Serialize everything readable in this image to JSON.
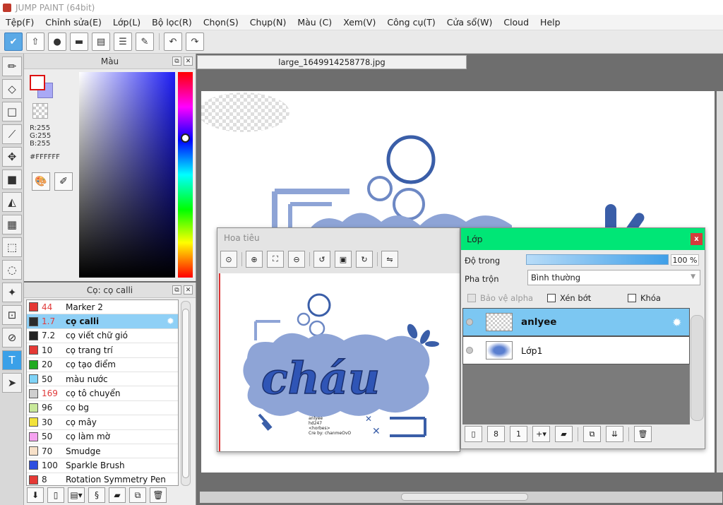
{
  "window": {
    "title": "JUMP PAINT (64bit)"
  },
  "menu": [
    "Tệp(F)",
    "Chỉnh sửa(E)",
    "Lớp(L)",
    "Bộ lọc(R)",
    "Chọn(S)",
    "Chụp(N)",
    "Màu (C)",
    "Xem(V)",
    "Công cụ(T)",
    "Cửa sổ(W)",
    "Cloud",
    "Help"
  ],
  "color_panel": {
    "title": "Màu",
    "rgb": {
      "r": "R:255",
      "g": "G:255",
      "b": "B:255"
    },
    "hex": "#FFFFFF",
    "fg_color": "#ffffff",
    "bg_color": "#a9a9f5"
  },
  "brush_panel": {
    "title": "Cọ: cọ calli",
    "items": [
      {
        "size": "44",
        "name": "Marker 2",
        "color": "#e53935",
        "size_red": true
      },
      {
        "size": "1.7",
        "name": "cọ calli",
        "color": "#2b2b2b",
        "size_red": true,
        "selected": true
      },
      {
        "size": "7.2",
        "name": "cọ viết chữ gió",
        "color": "#222222"
      },
      {
        "size": "10",
        "name": "cọ trang trí",
        "color": "#e53935"
      },
      {
        "size": "20",
        "name": "cọ tạo điểm",
        "color": "#22aa22"
      },
      {
        "size": "50",
        "name": "màu nước",
        "color": "#7fd3f7"
      },
      {
        "size": "169",
        "name": "cọ tô chuyển",
        "color": "#cfcfcf",
        "size_red": true
      },
      {
        "size": "96",
        "name": "cọ bg",
        "color": "#c8e89a"
      },
      {
        "size": "30",
        "name": "cọ mây",
        "color": "#f2e23a"
      },
      {
        "size": "50",
        "name": "cọ làm mờ",
        "color": "#f5a3f0"
      },
      {
        "size": "70",
        "name": "Smudge",
        "color": "#f7e0c8"
      },
      {
        "size": "100",
        "name": "Sparkle Brush",
        "color": "#2e4fe0"
      },
      {
        "size": "8",
        "name": "Rotation Symmetry Pen",
        "color": "#e53935"
      }
    ]
  },
  "document": {
    "tab": "large_1649914258778.jpg"
  },
  "navigator": {
    "title": "Hoa tiêu"
  },
  "layers": {
    "title": "Lớp",
    "close": "x",
    "opacity_label": "Độ trong",
    "opacity_value": "100 %",
    "opacity_fraction": 1.0,
    "blend_label": "Pha trộn",
    "blend_value": "Bình thường",
    "protect_alpha": "Bảo vệ alpha",
    "clipping": "Xén bớt",
    "lock": "Khóa",
    "items": [
      {
        "name": "anlyee",
        "selected": true
      },
      {
        "name": "Lớp1",
        "selected": false
      }
    ]
  },
  "artwork": {
    "text": "cháu",
    "credits": [
      "anlyee",
      "hd247",
      "<horbes>",
      "Cre by: chanmeOvO"
    ]
  }
}
